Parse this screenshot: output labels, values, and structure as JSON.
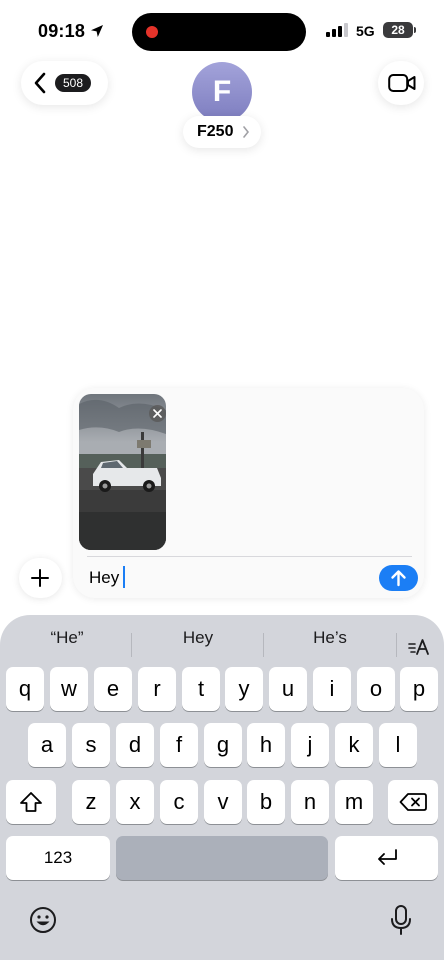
{
  "status_bar": {
    "time": "09:18",
    "location_icon": "location-arrow-icon",
    "network": "5G",
    "battery_level": "28",
    "recording_indicator_color": "#e5332a"
  },
  "header": {
    "back_icon": "chevron-left-icon",
    "unread_count": "508",
    "avatar_initial": "F",
    "contact_name": "F250",
    "video_call_icon": "video-camera-icon"
  },
  "compose": {
    "add_icon": "plus-icon",
    "attachment_icon": "photo-thumbnail",
    "remove_icon": "close-icon",
    "message_text": "Hey",
    "send_icon": "arrow-up-icon",
    "accent_color": "#1b7ef5"
  },
  "keyboard": {
    "suggestions": [
      "“He”",
      "Hey",
      "He’s"
    ],
    "format_icon": "text-format-icon",
    "rows": [
      [
        "q",
        "w",
        "e",
        "r",
        "t",
        "y",
        "u",
        "i",
        "o",
        "p"
      ],
      [
        "a",
        "s",
        "d",
        "f",
        "g",
        "h",
        "j",
        "k",
        "l"
      ],
      [
        "z",
        "x",
        "c",
        "v",
        "b",
        "n",
        "m"
      ]
    ],
    "numbers_key": "123",
    "shift_icon": "shift-icon",
    "delete_icon": "delete-backspace-icon",
    "return_icon": "return-icon",
    "emoji_icon": "emoji-icon",
    "mic_icon": "microphone-icon"
  }
}
